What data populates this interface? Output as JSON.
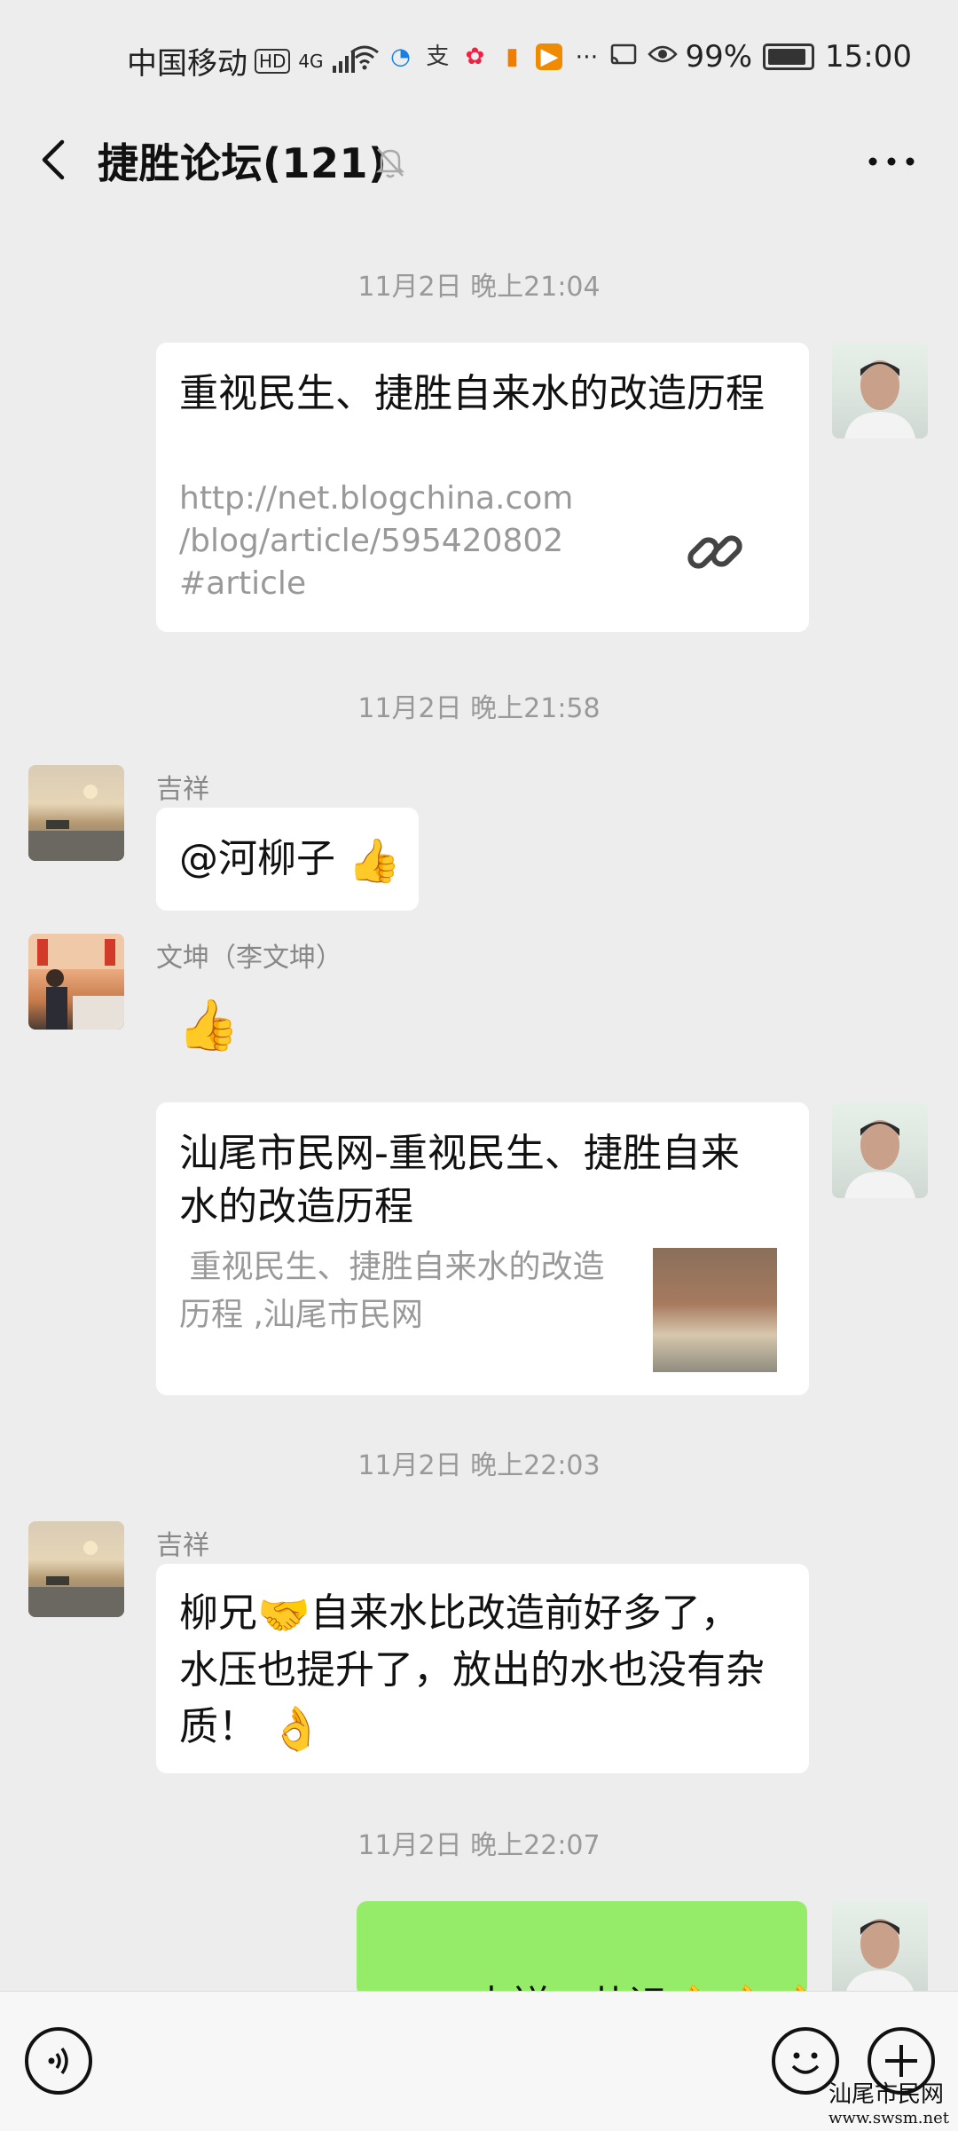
{
  "status": {
    "carrier": "中国移动",
    "hd": "HD",
    "network": "4G",
    "battery": "99%",
    "time": "15:00"
  },
  "header": {
    "title": "捷胜论坛(121)"
  },
  "timestamps": [
    "11月2日 晚上21:04",
    "11月2日 晚上21:58",
    "11月2日 晚上22:03",
    "11月2日 晚上22:07"
  ],
  "messages": {
    "m1": {
      "title": "重视民生、捷胜自来水的改造历程",
      "link_line1": "http://net.blogchina.com",
      "link_line2": "/blog/article/595420802",
      "link_line3": "#article"
    },
    "m2": {
      "sender": "吉祥",
      "text": "@河柳子"
    },
    "m3": {
      "sender": "文坤（李文坤）"
    },
    "m4": {
      "title_line1": "汕尾市民网-重视民生、捷胜自来",
      "title_line2": "水的改造历程",
      "desc_line1": " 重视民生、捷胜自来水的改造",
      "desc_line2": "历程 ,汕尾市民网"
    },
    "m5": {
      "sender": "吉祥",
      "line1_a": "柳兄",
      "line1_b": "自来水比改造前好多了，",
      "line2": "水压也提升了，放出的水也没有杂",
      "line3": "质！"
    },
    "m6": {
      "text": "@吉祥　共识"
    }
  },
  "watermark": {
    "line1": "汕尾市民网",
    "line2": "www.swsm.net"
  }
}
